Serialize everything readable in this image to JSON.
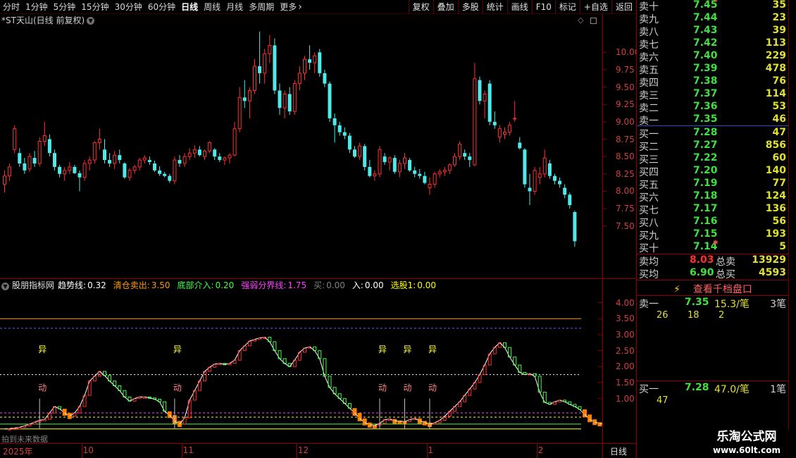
{
  "toolbar": {
    "periods": [
      "分时",
      "1分钟",
      "5分钟",
      "15分钟",
      "30分钟",
      "60分钟",
      "日线",
      "周线",
      "月线",
      "多周期",
      "更多"
    ],
    "active_period": "日线",
    "buttons": [
      "复权",
      "叠加",
      "多股",
      "统计",
      "画线",
      "F10",
      "标记",
      "+自选",
      "返回"
    ]
  },
  "main": {
    "title": "*ST天山(日线 前复权)",
    "y_ticks": [
      "10.00",
      "9.75",
      "9.50",
      "9.25",
      "9.00",
      "8.75",
      "8.50",
      "8.25",
      "8.00",
      "7.75",
      "7.50"
    ]
  },
  "indicator": {
    "name": "股朋指标网",
    "items": [
      {
        "label": "趋势线:",
        "value": "0.32",
        "color": "#ffffff"
      },
      {
        "label": "清仓卖出:",
        "value": "3.50",
        "color": "#ff9900"
      },
      {
        "label": "底部介入:",
        "value": "0.20",
        "color": "#40ff40"
      },
      {
        "label": "强弱分界线:",
        "value": "1.75",
        "color": "#ff40ff"
      },
      {
        "label": "买:",
        "value": "0.00",
        "color": "#808080"
      },
      {
        "label": "入:",
        "value": "0.00",
        "color": "#ffffff"
      },
      {
        "label": "选股1:",
        "value": "0.00",
        "color": "#ffff00"
      }
    ],
    "y_ticks": [
      "4.00",
      "3.50",
      "3.00",
      "2.50",
      "2.00",
      "1.50",
      "1.00"
    ],
    "yi_label": "异",
    "dong_label": "动",
    "future_label": "拍到未来数据"
  },
  "dates": {
    "labels": [
      "2025年",
      "10",
      "11",
      "12",
      "1",
      "2"
    ],
    "period": "日线"
  },
  "chart_data": [
    {
      "type": "candlestick",
      "title": "*ST天山(日线 前复权)",
      "ylim": [
        7.0,
        10.5
      ],
      "candles": [
        [
          8.1,
          8.3,
          7.98,
          8.22
        ],
        [
          8.22,
          8.4,
          8.15,
          8.35
        ],
        [
          8.6,
          8.95,
          8.55,
          8.9
        ],
        [
          8.55,
          8.62,
          8.35,
          8.4
        ],
        [
          8.4,
          8.48,
          8.25,
          8.3
        ],
        [
          8.32,
          8.55,
          8.28,
          8.5
        ],
        [
          8.48,
          8.58,
          8.35,
          8.4
        ],
        [
          8.4,
          8.78,
          8.36,
          8.72
        ],
        [
          8.72,
          9.0,
          8.65,
          8.8
        ],
        [
          8.75,
          8.82,
          8.5,
          8.55
        ],
        [
          8.55,
          8.6,
          8.3,
          8.35
        ],
        [
          8.35,
          8.38,
          8.2,
          8.25
        ],
        [
          8.25,
          8.35,
          8.15,
          8.3
        ],
        [
          8.3,
          8.42,
          8.25,
          8.35
        ],
        [
          8.35,
          8.38,
          8.25,
          8.26
        ],
        [
          8.26,
          8.3,
          8.0,
          8.2
        ],
        [
          8.2,
          8.45,
          8.15,
          8.4
        ],
        [
          8.4,
          8.5,
          8.3,
          8.45
        ],
        [
          8.45,
          8.72,
          8.4,
          8.7
        ],
        [
          8.7,
          8.9,
          8.6,
          8.75
        ],
        [
          8.6,
          8.75,
          8.4,
          8.45
        ],
        [
          8.45,
          8.55,
          8.35,
          8.4
        ],
        [
          8.4,
          8.58,
          8.32,
          8.52
        ],
        [
          8.52,
          8.6,
          8.4,
          8.45
        ],
        [
          8.4,
          8.42,
          8.18,
          8.2
        ],
        [
          8.2,
          8.33,
          8.15,
          8.3
        ],
        [
          8.3,
          8.38,
          8.25,
          8.35
        ],
        [
          8.35,
          8.48,
          8.3,
          8.45
        ],
        [
          8.45,
          8.52,
          8.4,
          8.48
        ],
        [
          8.45,
          8.5,
          8.38,
          8.42
        ],
        [
          8.4,
          8.44,
          8.28,
          8.3
        ],
        [
          8.3,
          8.36,
          8.22,
          8.25
        ],
        [
          8.25,
          8.28,
          8.2,
          8.22
        ],
        [
          8.22,
          8.25,
          8.12,
          8.15
        ],
        [
          8.15,
          8.5,
          8.1,
          8.45
        ],
        [
          8.45,
          8.52,
          8.35,
          8.4
        ],
        [
          8.4,
          8.55,
          8.35,
          8.5
        ],
        [
          8.5,
          8.62,
          8.45,
          8.55
        ],
        [
          8.55,
          8.66,
          8.48,
          8.6
        ],
        [
          8.6,
          8.65,
          8.5,
          8.52
        ],
        [
          8.5,
          8.6,
          8.45,
          8.58
        ],
        [
          8.58,
          8.72,
          8.55,
          8.7
        ],
        [
          8.6,
          8.62,
          8.45,
          8.5
        ],
        [
          8.5,
          8.55,
          8.42,
          8.45
        ],
        [
          8.45,
          8.5,
          8.38,
          8.48
        ],
        [
          8.48,
          8.55,
          8.4,
          8.52
        ],
        [
          8.52,
          9.0,
          8.5,
          8.9
        ],
        [
          8.9,
          9.5,
          8.85,
          9.35
        ],
        [
          9.35,
          9.6,
          9.2,
          9.3
        ],
        [
          9.3,
          9.5,
          9.05,
          9.45
        ],
        [
          9.45,
          9.9,
          9.4,
          9.8
        ],
        [
          9.8,
          10.3,
          9.55,
          9.7
        ],
        [
          9.7,
          10.05,
          9.55,
          9.98
        ],
        [
          9.98,
          10.25,
          9.85,
          10.1
        ],
        [
          10.1,
          10.2,
          9.4,
          9.45
        ],
        [
          9.45,
          9.55,
          9.1,
          9.2
        ],
        [
          9.2,
          9.45,
          9.05,
          9.4
        ],
        [
          9.4,
          9.5,
          9.1,
          9.15
        ],
        [
          9.15,
          9.6,
          9.1,
          9.55
        ],
        [
          9.55,
          9.8,
          9.45,
          9.7
        ],
        [
          9.7,
          9.95,
          9.6,
          9.9
        ],
        [
          9.9,
          10.1,
          9.75,
          9.85
        ],
        [
          9.85,
          10.0,
          9.7,
          9.95
        ],
        [
          10.0,
          10.05,
          9.65,
          9.7
        ],
        [
          9.7,
          9.75,
          9.5,
          9.55
        ],
        [
          9.55,
          9.58,
          9.0,
          9.05
        ],
        [
          9.05,
          9.12,
          8.7,
          8.95
        ],
        [
          8.95,
          9.0,
          8.8,
          8.85
        ],
        [
          8.85,
          8.92,
          8.75,
          8.8
        ],
        [
          8.8,
          8.84,
          8.55,
          8.6
        ],
        [
          8.6,
          8.65,
          8.48,
          8.5
        ],
        [
          8.5,
          8.7,
          8.45,
          8.65
        ],
        [
          8.65,
          8.68,
          8.3,
          8.35
        ],
        [
          8.35,
          8.45,
          8.2,
          8.22
        ],
        [
          8.22,
          8.3,
          8.15,
          8.25
        ],
        [
          8.25,
          8.65,
          8.2,
          8.6
        ],
        [
          8.5,
          8.55,
          8.38,
          8.42
        ],
        [
          8.42,
          8.5,
          8.3,
          8.48
        ],
        [
          8.48,
          8.52,
          8.25,
          8.28
        ],
        [
          8.28,
          8.45,
          8.2,
          8.4
        ],
        [
          8.4,
          8.55,
          8.32,
          8.48
        ],
        [
          8.45,
          8.48,
          8.28,
          8.3
        ],
        [
          8.3,
          8.35,
          8.2,
          8.25
        ],
        [
          8.25,
          8.32,
          8.18,
          8.22
        ],
        [
          8.22,
          8.28,
          8.1,
          8.12
        ],
        [
          8.05,
          8.2,
          7.95,
          8.1
        ],
        [
          8.1,
          8.28,
          8.05,
          8.25
        ],
        [
          8.25,
          8.32,
          8.2,
          8.28
        ],
        [
          8.28,
          8.35,
          8.22,
          8.3
        ],
        [
          8.3,
          8.4,
          8.25,
          8.38
        ],
        [
          8.38,
          8.55,
          8.35,
          8.5
        ],
        [
          8.5,
          8.72,
          8.45,
          8.68
        ],
        [
          8.55,
          8.6,
          8.45,
          8.5
        ],
        [
          8.5,
          8.55,
          8.35,
          8.45
        ],
        [
          8.38,
          9.85,
          8.36,
          9.62
        ],
        [
          9.6,
          9.65,
          9.25,
          9.3
        ],
        [
          9.3,
          9.45,
          9.05,
          9.4
        ],
        [
          9.55,
          9.6,
          8.95,
          9.0
        ],
        [
          9.0,
          9.15,
          8.9,
          8.95
        ],
        [
          8.78,
          8.95,
          8.7,
          8.9
        ],
        [
          8.82,
          8.92,
          8.75,
          8.85
        ],
        [
          8.85,
          9.0,
          8.8,
          8.95
        ],
        [
          9.05,
          9.3,
          9.0,
          9.05
        ],
        [
          8.7,
          8.78,
          8.6,
          8.62
        ],
        [
          8.6,
          8.62,
          8.05,
          8.1
        ],
        [
          8.05,
          8.25,
          7.8,
          8.0
        ],
        [
          8.0,
          8.35,
          7.95,
          8.3
        ],
        [
          8.2,
          8.35,
          8.1,
          8.25
        ],
        [
          8.25,
          8.6,
          8.2,
          8.48
        ],
        [
          8.4,
          8.45,
          8.18,
          8.22
        ],
        [
          8.22,
          8.25,
          8.1,
          8.15
        ],
        [
          8.15,
          8.2,
          8.05,
          8.1
        ],
        [
          8.05,
          8.1,
          7.9,
          7.95
        ],
        [
          7.95,
          7.98,
          7.75,
          7.8
        ],
        [
          7.7,
          7.72,
          7.2,
          7.28
        ]
      ]
    },
    {
      "type": "line",
      "title": "股朋指标网",
      "ylim": [
        0.0,
        4.3
      ],
      "series": [
        {
          "name": "趋势线",
          "values": [
            0.05,
            0.06,
            0.08,
            0.1,
            0.15,
            0.2,
            0.26,
            0.32,
            0.35,
            0.55,
            0.75,
            0.68,
            0.55,
            0.45,
            0.55,
            0.75,
            1.1,
            1.55,
            1.7,
            1.85,
            1.72,
            1.55,
            1.4,
            1.25,
            1.05,
            0.92,
            1.0,
            1.05,
            1.05,
            1.02,
            0.98,
            0.9,
            0.6,
            0.48,
            0.3,
            0.2,
            0.4,
            0.95,
            1.25,
            1.55,
            1.85,
            1.98,
            2.08,
            2.1,
            2.07,
            2.1,
            2.2,
            2.5,
            2.65,
            2.8,
            2.85,
            2.9,
            2.92,
            2.78,
            2.5,
            2.25,
            2.1,
            2.0,
            2.2,
            2.45,
            2.58,
            2.62,
            2.5,
            2.25,
            1.7,
            1.35,
            1.15,
            1.0,
            0.85,
            0.7,
            0.55,
            0.38,
            0.25,
            0.18,
            0.16,
            0.22,
            0.34,
            0.36,
            0.3,
            0.3,
            0.28,
            0.34,
            0.38,
            0.3,
            0.25,
            0.2,
            0.24,
            0.32,
            0.45,
            0.6,
            0.75,
            0.9,
            1.1,
            1.3,
            1.5,
            1.75,
            2.05,
            2.4,
            2.6,
            2.75,
            2.6,
            2.3,
            2.05,
            1.82,
            1.75,
            1.78,
            1.7,
            1.2,
            0.88,
            0.82,
            0.9,
            0.95,
            0.9,
            0.82,
            0.75,
            0.66,
            0.5,
            0.35,
            0.26,
            0.22,
            0.2
          ]
        },
        {
          "name": "清仓卖出",
          "values": [
            3.5
          ]
        },
        {
          "name": "底部介入",
          "values": [
            0.2
          ]
        },
        {
          "name": "强弱分界线",
          "values": [
            1.75
          ]
        }
      ]
    }
  ],
  "book": {
    "sell": [
      {
        "name": "卖十",
        "price": "7.45",
        "vol": "35",
        "mark": "≈"
      },
      {
        "name": "卖九",
        "price": "7.44",
        "vol": "23"
      },
      {
        "name": "卖八",
        "price": "7.43",
        "vol": "39"
      },
      {
        "name": "卖七",
        "price": "7.42",
        "vol": "113"
      },
      {
        "name": "卖六",
        "price": "7.40",
        "vol": "229"
      },
      {
        "name": "卖五",
        "price": "7.39",
        "vol": "478"
      },
      {
        "name": "卖四",
        "price": "7.38",
        "vol": "76"
      },
      {
        "name": "卖三",
        "price": "7.37",
        "vol": "114"
      },
      {
        "name": "卖二",
        "price": "7.36",
        "vol": "53"
      },
      {
        "name": "卖一",
        "price": "7.35",
        "vol": "46"
      }
    ],
    "buy": [
      {
        "name": "买一",
        "price": "7.28",
        "vol": "47"
      },
      {
        "name": "买二",
        "price": "7.27",
        "vol": "856"
      },
      {
        "name": "买三",
        "price": "7.22",
        "vol": "60"
      },
      {
        "name": "买四",
        "price": "7.20",
        "vol": "140"
      },
      {
        "name": "买五",
        "price": "7.19",
        "vol": "77"
      },
      {
        "name": "买六",
        "price": "7.18",
        "vol": "124"
      },
      {
        "name": "买七",
        "price": "7.17",
        "vol": "136"
      },
      {
        "name": "买八",
        "price": "7.16",
        "vol": "56"
      },
      {
        "name": "买九",
        "price": "7.15",
        "vol": "193"
      },
      {
        "name": "买十",
        "price": "7.14",
        "vol": "5",
        "mark": "✱"
      }
    ],
    "avg": [
      {
        "name": "卖均",
        "price": "8.03",
        "label": "总卖",
        "vol": "13929"
      },
      {
        "name": "买均",
        "price": "6.90",
        "label": "总买",
        "vol": "4593"
      }
    ],
    "qiandang": "查看千档盘口",
    "sell_queue": {
      "name": "卖一",
      "price": "7.35",
      "size": "15.3/笔",
      "count": "3笔",
      "orders": [
        "26",
        "18",
        "2"
      ]
    },
    "buy_queue": {
      "name": "买一",
      "price": "7.28",
      "size": "47.0/笔",
      "count": "1笔",
      "orders": [
        "47"
      ]
    },
    "colors": {
      "up": "#ff3030",
      "down": "#50e8e8",
      "neutral": "#e0e0e0",
      "price_green": "#40e040"
    }
  },
  "watermark": {
    "line1": "乐淘公式网",
    "line2": "www.60lt.com"
  }
}
